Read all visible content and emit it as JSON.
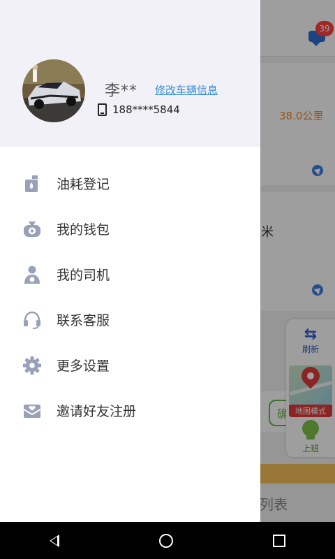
{
  "background_app": {
    "message_badge": "39",
    "distance": "38.0公里",
    "unit_fragment": "米",
    "confirm_fragment": "确",
    "list_fragment": "列表",
    "fab": {
      "refresh_label": "刷新",
      "map_label": "地图模式",
      "work_label": "上班"
    }
  },
  "drawer": {
    "user_name": "李**",
    "edit_vehicle_link": "修改车辆信息",
    "phone": "188****5844",
    "menu": [
      {
        "label": "油耗登记",
        "icon": "fuel-icon"
      },
      {
        "label": "我的钱包",
        "icon": "wallet-icon"
      },
      {
        "label": "我的司机",
        "icon": "driver-icon"
      },
      {
        "label": "联系客服",
        "icon": "headset-icon"
      },
      {
        "label": "更多设置",
        "icon": "gear-icon"
      },
      {
        "label": "邀请好友注册",
        "icon": "mail-icon"
      }
    ]
  },
  "colors": {
    "accent_link": "#3b8fd6",
    "icon_gray": "#9aa0b7",
    "header_bg": "#f1f1f7",
    "badge_red": "#ff4040",
    "distance_orange": "#f08a2a"
  }
}
